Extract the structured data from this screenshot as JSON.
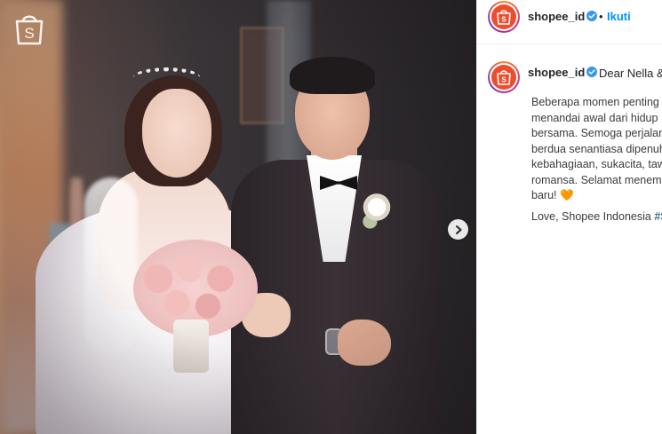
{
  "post": {
    "header": {
      "username": "shopee_id",
      "separator": "•",
      "follow_label": "Ikuti"
    },
    "caption": {
      "username": "shopee_id",
      "lead": "Dear Nella &",
      "lines": [
        "Beberapa momen penting",
        "menandai awal dari hidup",
        "bersama. Semoga perjalan",
        "berdua senantiasa dipenuh",
        "kebahagiaan, sukacita, taw",
        "romansa. Selamat menemp",
        "baru! "
      ],
      "heart": "🧡",
      "sign_text": "Love, Shopee Indonesia ",
      "sign_hashtag": "#S"
    },
    "image": {
      "watermark_letter": "S",
      "avatar_letter": "S",
      "next_icon": "chevron-right-icon"
    }
  },
  "colors": {
    "shopee_orange": "#ee4d2d",
    "instagram_blue": "#0095f6",
    "verified_blue": "#3897f0",
    "text_primary": "#262626"
  }
}
